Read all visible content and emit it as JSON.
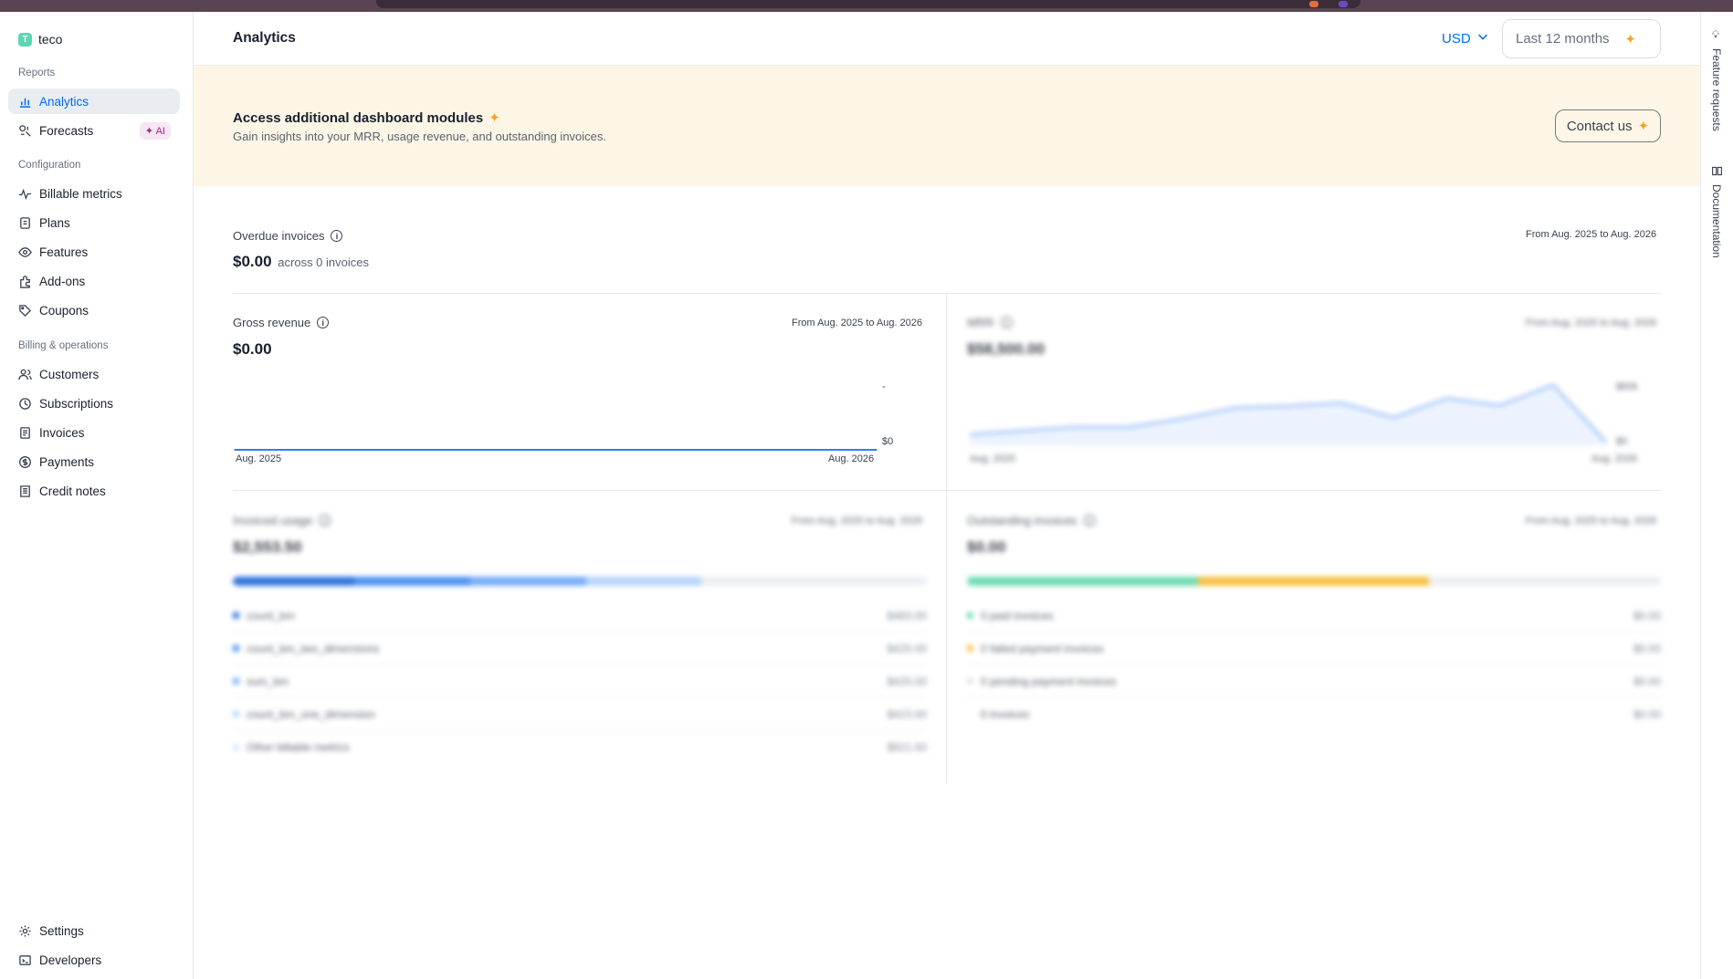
{
  "org": {
    "initial": "T",
    "name": "teco"
  },
  "sidebar": {
    "sections": [
      {
        "title": "Reports",
        "items": [
          {
            "label": "Analytics",
            "icon": "bar-chart-icon",
            "active": true
          },
          {
            "label": "Forecasts",
            "icon": "forecast-icon",
            "badge": "AI"
          }
        ]
      },
      {
        "title": "Configuration",
        "items": [
          {
            "label": "Billable metrics",
            "icon": "pulse-icon"
          },
          {
            "label": "Plans",
            "icon": "plans-icon"
          },
          {
            "label": "Features",
            "icon": "eye-icon"
          },
          {
            "label": "Add-ons",
            "icon": "puzzle-icon"
          },
          {
            "label": "Coupons",
            "icon": "tag-icon"
          }
        ]
      },
      {
        "title": "Billing & operations",
        "items": [
          {
            "label": "Customers",
            "icon": "users-icon"
          },
          {
            "label": "Subscriptions",
            "icon": "clock-icon"
          },
          {
            "label": "Invoices",
            "icon": "invoice-icon"
          },
          {
            "label": "Payments",
            "icon": "dollar-icon"
          },
          {
            "label": "Credit notes",
            "icon": "receipt-icon"
          }
        ]
      }
    ],
    "footer": [
      {
        "label": "Settings",
        "icon": "gear-icon"
      },
      {
        "label": "Developers",
        "icon": "terminal-icon"
      }
    ]
  },
  "header": {
    "title": "Analytics",
    "currency": "USD",
    "range": "Last 12 months"
  },
  "banner": {
    "title": "Access additional dashboard modules",
    "subtitle": "Gain insights into your MRR, usage revenue, and outstanding invoices.",
    "cta": "Contact us"
  },
  "rightbar": {
    "feature_requests": "Feature requests",
    "documentation": "Documentation"
  },
  "overdue": {
    "title": "Overdue invoices",
    "value": "$0.00",
    "sub": "across 0 invoices",
    "range": "From Aug. 2025 to Aug. 2026"
  },
  "gross_revenue": {
    "title": "Gross revenue",
    "value": "$0.00",
    "range": "From Aug. 2025 to Aug. 2026",
    "x_start": "Aug. 2025",
    "x_end": "Aug. 2026",
    "y_top": "-",
    "y_zero": "$0"
  },
  "chart_data": {
    "type": "line",
    "x": [
      "Aug. 2025",
      "Aug. 2026"
    ],
    "series": [
      {
        "values": [
          0,
          0
        ]
      }
    ],
    "xlabel": "",
    "ylabel": "",
    "title": "Gross revenue"
  },
  "mrr": {
    "title": "MRR",
    "value": "$58,500.00",
    "range": "From Aug. 2025 to Aug. 2026",
    "y_top": "$60k",
    "y_zero": "$0",
    "x_start": "Aug. 2025",
    "x_end": "Aug. 2026",
    "trend": [
      0.18,
      0.24,
      0.3,
      0.3,
      0.44,
      0.62,
      0.65,
      0.7,
      0.46,
      0.78,
      0.66,
      1.0,
      0.05
    ]
  },
  "invoiced_usage": {
    "title": "Invoiced usage",
    "value": "$2,553.50",
    "range": "From Aug. 2025 to Aug. 2026",
    "colors": [
      "#0a5ad6",
      "#2f7ff0",
      "#5f9ff5",
      "#a9cdfb"
    ],
    "rows": [
      {
        "label": "count_bm",
        "amount": "$483.00",
        "color": "#0a5ad6"
      },
      {
        "label": "count_bm_two_dimensions",
        "amount": "$425.00",
        "color": "#2f7ff0"
      },
      {
        "label": "sum_bm",
        "amount": "$425.00",
        "color": "#5f9ff5"
      },
      {
        "label": "count_bm_one_dimension",
        "amount": "$423.00",
        "color": "#a9cdfb"
      },
      {
        "label": "Other billable metrics",
        "amount": "$821.50",
        "color": "#d7e6fb"
      }
    ]
  },
  "outstanding": {
    "title": "Outstanding invoices",
    "value": "$0.00",
    "range": "From Aug. 2025 to Aug. 2026",
    "rows": [
      {
        "label": "0 paid invoices",
        "amount": "$0.00",
        "color": "#56d6a5"
      },
      {
        "label": "0 failed payment invoices",
        "amount": "$0.00",
        "color": "#f5b524"
      },
      {
        "label": "0 pending payment invoices",
        "amount": "$0.00",
        "color": "#d9dde3"
      },
      {
        "label": "0 invoices",
        "amount": "$0.00",
        "color": "transparent"
      }
    ]
  }
}
